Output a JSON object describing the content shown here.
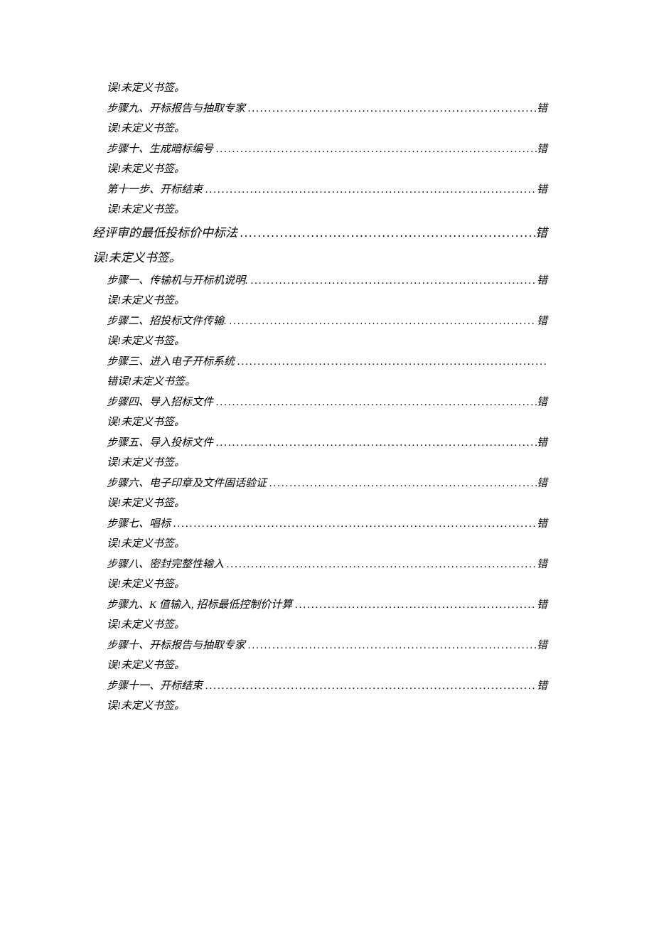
{
  "entries": [
    {
      "type": "error",
      "level": "n",
      "indent": 1,
      "text": "误!未定义书签。"
    },
    {
      "type": "entry",
      "level": "n",
      "indent": 1,
      "label": "步骤九、开标报告与抽取专家",
      "page": "错"
    },
    {
      "type": "error",
      "level": "n",
      "indent": 1,
      "text": "误!未定义书签。"
    },
    {
      "type": "entry",
      "level": "n",
      "indent": 1,
      "label": "步骤十、生成暗标编号",
      "page": "错"
    },
    {
      "type": "error",
      "level": "n",
      "indent": 1,
      "text": "误!未定义书签。"
    },
    {
      "type": "entry",
      "level": "n",
      "indent": 1,
      "label": "第十一步、开标结束",
      "page": "错"
    },
    {
      "type": "error",
      "level": "n",
      "indent": 1,
      "text": "误!未定义书签。"
    },
    {
      "type": "entry",
      "level": "h",
      "indent": 0,
      "label": "经评审的最低投标价中标法",
      "page": "错"
    },
    {
      "type": "error",
      "level": "h",
      "indent": 0,
      "text": "误!未定义书签。"
    },
    {
      "type": "entry",
      "level": "n",
      "indent": 1,
      "label": "步骤一、传输机与开标机说明.",
      "page": "错"
    },
    {
      "type": "error",
      "level": "n",
      "indent": 1,
      "text": "误!未定义书签。"
    },
    {
      "type": "entry",
      "level": "n",
      "indent": 1,
      "label": "步骤二、招投标文件传输.",
      "page": "错"
    },
    {
      "type": "error",
      "level": "n",
      "indent": 1,
      "text": "误!未定义书签。"
    },
    {
      "type": "entry",
      "level": "n",
      "indent": 1,
      "label": "步骤三、进入电子开标系统",
      "page": "",
      "nodots": false
    },
    {
      "type": "error",
      "level": "n",
      "indent": 1,
      "text": "错误!未定义书签。"
    },
    {
      "type": "entry",
      "level": "n",
      "indent": 1,
      "label": "步骤四、导入招标文件",
      "page": "错"
    },
    {
      "type": "error",
      "level": "n",
      "indent": 1,
      "text": "误!未定义书签。"
    },
    {
      "type": "entry",
      "level": "n",
      "indent": 1,
      "label": "步骤五、导入投标文件",
      "page": "错"
    },
    {
      "type": "error",
      "level": "n",
      "indent": 1,
      "text": "误!未定义书签。"
    },
    {
      "type": "entry",
      "level": "n",
      "indent": 1,
      "label": "步骤六、电子印章及文件固话验证",
      "page": "错"
    },
    {
      "type": "error",
      "level": "n",
      "indent": 1,
      "text": "误!未定义书签。"
    },
    {
      "type": "entry",
      "level": "n",
      "indent": 1,
      "label": "步骤七、唱标",
      "page": "错"
    },
    {
      "type": "error",
      "level": "n",
      "indent": 1,
      "text": "误!未定义书签。"
    },
    {
      "type": "entry",
      "level": "n",
      "indent": 1,
      "label": "步骤八、密封完整性输入",
      "page": "错"
    },
    {
      "type": "error",
      "level": "n",
      "indent": 1,
      "text": "误!未定义书签。"
    },
    {
      "type": "entry",
      "level": "n",
      "indent": 1,
      "label": "步骤九、K 值输入, 招标最低控制价计算",
      "page": "错"
    },
    {
      "type": "error",
      "level": "n",
      "indent": 1,
      "text": "误!未定义书签。"
    },
    {
      "type": "entry",
      "level": "n",
      "indent": 1,
      "label": "步骤十、开标报告与抽取专家",
      "page": "错"
    },
    {
      "type": "error",
      "level": "n",
      "indent": 1,
      "text": "误!未定义书签。"
    },
    {
      "type": "entry",
      "level": "n",
      "indent": 1,
      "label": "步骤十一、开标结束",
      "page": "错"
    },
    {
      "type": "error",
      "level": "n",
      "indent": 1,
      "text": "误!未定义书签。"
    }
  ]
}
